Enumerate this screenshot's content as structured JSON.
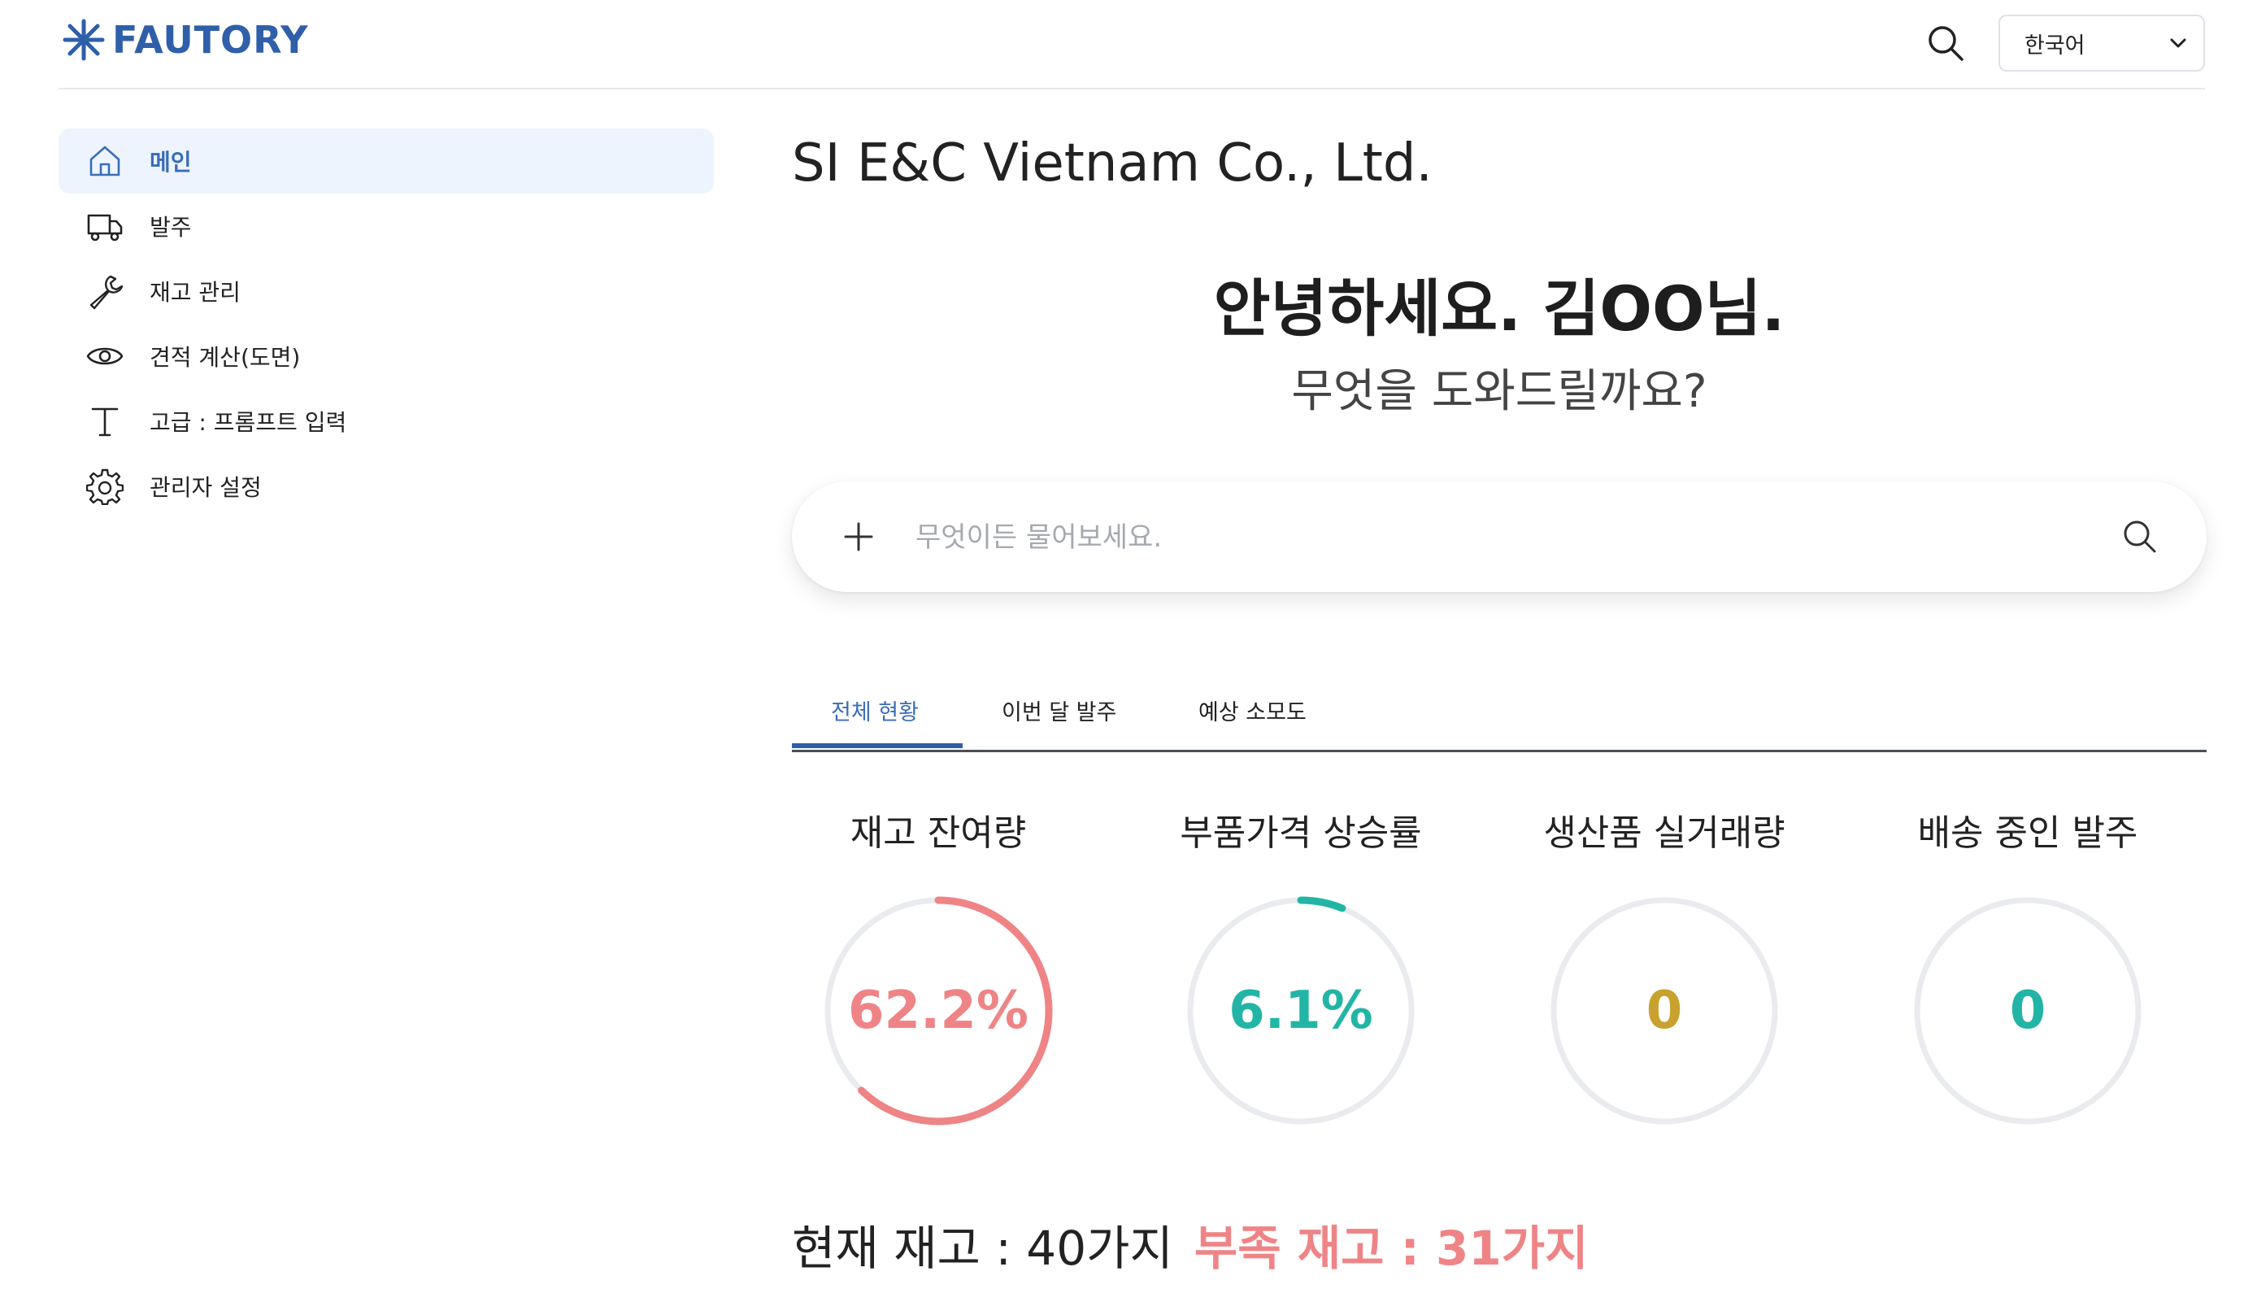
{
  "header": {
    "brand": "FAUTORY",
    "language": "한국어",
    "brand_color": "#2f5fa8"
  },
  "sidebar": {
    "items": [
      {
        "label": "메인",
        "icon": "home-icon",
        "active": true
      },
      {
        "label": "발주",
        "icon": "truck-icon",
        "active": false
      },
      {
        "label": "재고 관리",
        "icon": "wrench-icon",
        "active": false
      },
      {
        "label": "견적 계산(도면)",
        "icon": "eye-icon",
        "active": false
      },
      {
        "label": "고급 : 프롬프트 입력",
        "icon": "text-icon",
        "active": false
      },
      {
        "label": "관리자 설정",
        "icon": "gear-icon",
        "active": false
      }
    ]
  },
  "main": {
    "company": "SI E&C Vietnam Co., Ltd.",
    "greeting": "안녕하세요. 김OO님.",
    "greeting_sub": "무엇을 도와드릴까요?",
    "ask": {
      "placeholder": "무엇이든 물어보세요.",
      "value": ""
    },
    "tabs": [
      {
        "label": "전체 현황",
        "active": true
      },
      {
        "label": "이번 달 발주",
        "active": false
      },
      {
        "label": "예상 소모도",
        "active": false
      }
    ],
    "stats": [
      {
        "title": "재고 잔여량",
        "value": "62.2%",
        "fraction": 0.622,
        "color": "#ef8486"
      },
      {
        "title": "부품가격 상승률",
        "value": "6.1%",
        "fraction": 0.061,
        "color": "#22b5a6"
      },
      {
        "title": "생산품 실거래량",
        "value": "0",
        "fraction": 0,
        "color": "#c9a12e"
      },
      {
        "title": "배송 중인 발주",
        "value": "0",
        "fraction": 0,
        "color": "#22b5a6"
      }
    ],
    "summary": {
      "current": "현재 재고 :  40가지",
      "shortage": "부족 재고 : 31가지",
      "shortage_color": "#ef8486"
    }
  }
}
